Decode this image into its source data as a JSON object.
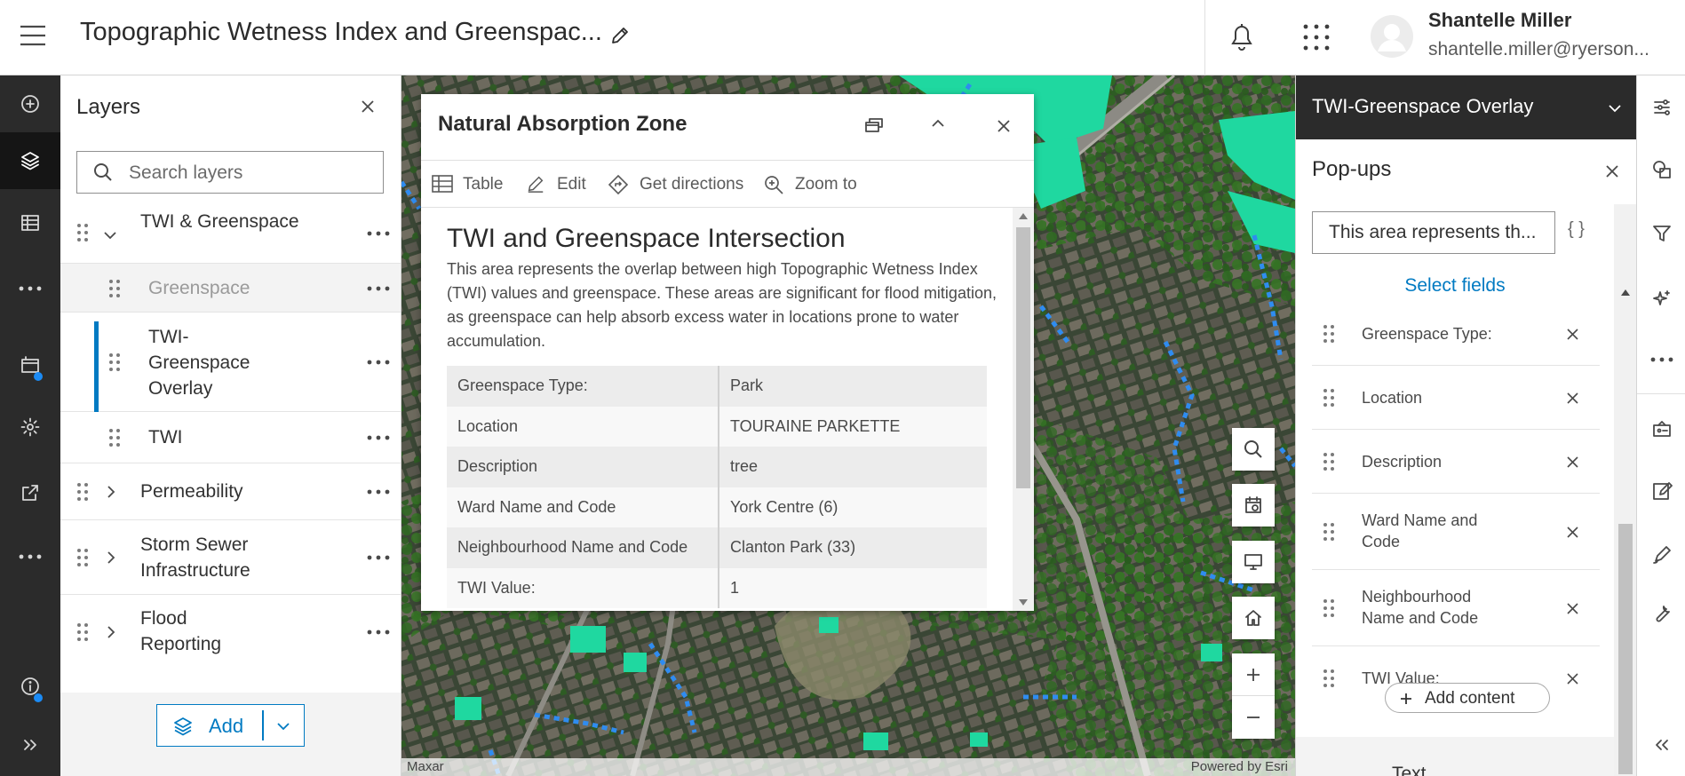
{
  "header": {
    "title": "Topographic Wetness Index and Greenspac...",
    "user_name": "Shantelle Miller",
    "user_email": "shantelle.miller@ryerson..."
  },
  "layers_panel": {
    "title": "Layers",
    "search_placeholder": "Search layers",
    "layers": [
      {
        "name": "TWI & Greenspace",
        "expanded": true
      },
      {
        "name": "Greenspace",
        "dimmed": true
      },
      {
        "name": "TWI-Greenspace Overlay",
        "selected": true
      },
      {
        "name": "TWI"
      },
      {
        "name": "Permeability"
      },
      {
        "name": "Storm Sewer Infrastructure"
      },
      {
        "name": "Flood Reporting"
      }
    ],
    "add_label": "Add"
  },
  "map": {
    "attribution_left": "Maxar",
    "attribution_right": "Powered by Esri"
  },
  "popup": {
    "title": "Natural Absorption Zone",
    "actions": {
      "table": "Table",
      "edit": "Edit",
      "directions": "Get directions",
      "zoom": "Zoom to"
    },
    "heading": "TWI and Greenspace Intersection",
    "description": "This area represents the overlap between high Topographic Wetness Index (TWI) values and greenspace. These areas are significant for flood mitigation, as greenspace can help absorb excess water in locations prone to water accumulation.",
    "fields": [
      {
        "label": "Greenspace Type:",
        "value": "Park"
      },
      {
        "label": "Location",
        "value": "TOURAINE PARKETTE"
      },
      {
        "label": "Description",
        "value": "tree"
      },
      {
        "label": "Ward Name and Code",
        "value": "York Centre (6)"
      },
      {
        "label": "Neighbourhood Name and Code",
        "value": "Clanton Park (33)"
      },
      {
        "label": "TWI Value:",
        "value": "1"
      }
    ]
  },
  "right_panel": {
    "layer_title": "TWI-Greenspace Overlay",
    "title": "Pop-ups",
    "text_value": "This area represents th...",
    "braces": "{ }",
    "select_fields": "Select fields",
    "fields": [
      "Greenspace Type:",
      "Location",
      "Description",
      "Ward Name and Code",
      "Neighbourhood Name and Code",
      "TWI Value:"
    ],
    "add_content": "Add content",
    "next_label": "Text"
  },
  "colors": {
    "accent": "#007ac2",
    "dark": "#2b2b2b",
    "twi_green": "#1fd8a0",
    "twi_blue": "#2f8cf0"
  }
}
